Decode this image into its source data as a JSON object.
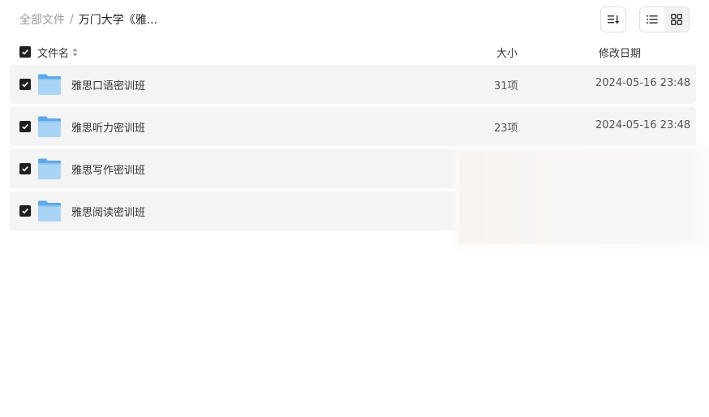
{
  "breadcrumb": {
    "root": "全部文件",
    "separator": "/",
    "current": "万门大学《雅..."
  },
  "toolbar": {
    "sort_icon": "sort-lines-icon",
    "list_view_icon": "list-view-icon",
    "grid_view_icon": "grid-view-icon"
  },
  "header": {
    "name": "文件名",
    "size": "大小",
    "date": "修改日期"
  },
  "files": [
    {
      "name": "雅思口语密训班",
      "size": "31项",
      "date": "2024-05-16 23:48",
      "checked": true
    },
    {
      "name": "雅思听力密训班",
      "size": "23项",
      "date": "2024-05-16 23:48",
      "checked": true
    },
    {
      "name": "雅思写作密训班",
      "size": "",
      "date": "",
      "checked": true
    },
    {
      "name": "雅思阅读密训班",
      "size": "",
      "date": "",
      "checked": true
    }
  ],
  "colors": {
    "row_bg": "#f4f4f4",
    "checkbox": "#1f1f1f",
    "folder_light": "#a9d4f5",
    "folder_dark": "#5ea8e8"
  }
}
